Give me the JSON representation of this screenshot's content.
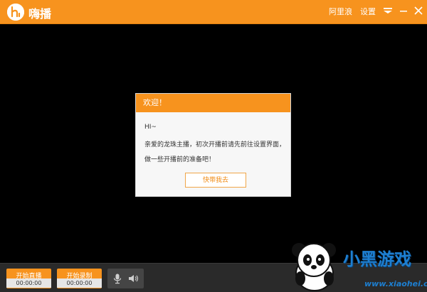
{
  "app": {
    "title": "嗨播"
  },
  "topbar": {
    "user_name": "阿里浪",
    "settings_label": "设置",
    "accent": "#f7931e"
  },
  "dialog": {
    "title": "欢迎！",
    "lines": [
      "HI~",
      "亲爱的龙珠主播，初次开播前请先前往设置界面，",
      "做一些开播前的准备吧！"
    ],
    "button_label": "快带我去"
  },
  "bottom": {
    "live": {
      "label": "开始直播",
      "time": "00:00:00"
    },
    "record": {
      "label": "开始录制",
      "time": "00:00:00"
    },
    "icons": {
      "mic": "microphone-icon",
      "speaker": "speaker-icon"
    }
  },
  "watermark": {
    "text": "小黑游戏",
    "url": "www.xiaohei.com"
  }
}
